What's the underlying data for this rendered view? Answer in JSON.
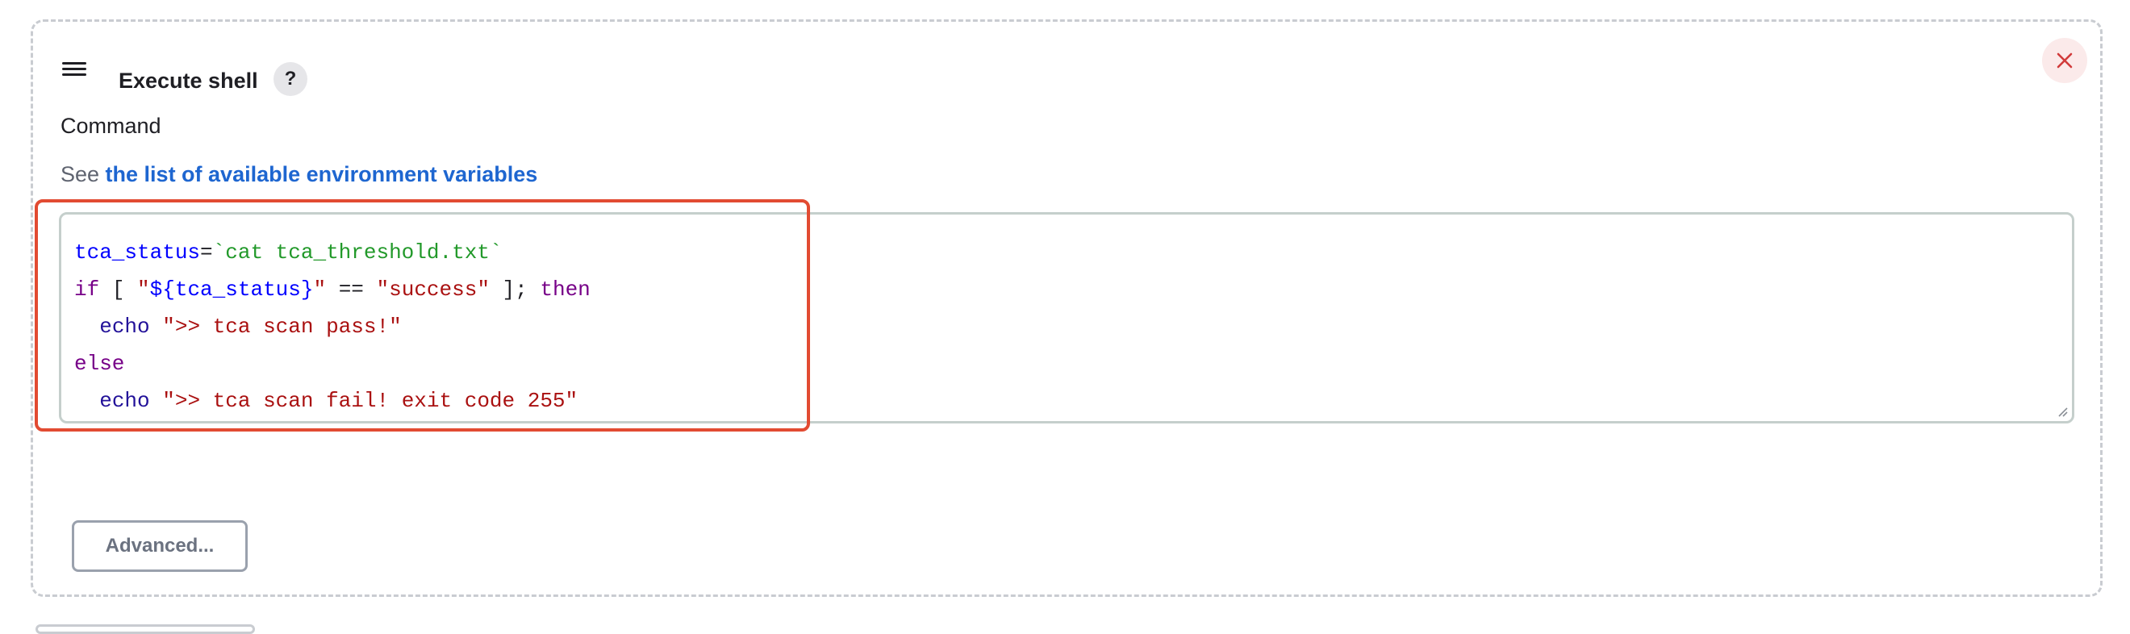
{
  "builder": {
    "title": "Execute shell",
    "help_label": "?",
    "close_icon": "close-icon",
    "handle_icon": "drag-handle-icon"
  },
  "command": {
    "label": "Command",
    "see_prefix": "See ",
    "env_link": "the list of available environment variables",
    "lines": [
      [
        [
          "var",
          "tca_status"
        ],
        [
          "plain",
          "="
        ],
        [
          "cmd",
          "`cat tca_threshold.txt`"
        ]
      ],
      [
        [
          "kw",
          "if"
        ],
        [
          "plain",
          " [ "
        ],
        [
          "str",
          "\""
        ],
        [
          "var",
          "${tca_status}"
        ],
        [
          "str",
          "\""
        ],
        [
          "plain",
          " == "
        ],
        [
          "str",
          "\"success\""
        ],
        [
          "plain",
          " ]; "
        ],
        [
          "kw",
          "then"
        ]
      ],
      [
        [
          "plain",
          "  "
        ],
        [
          "bi",
          "echo"
        ],
        [
          "plain",
          " "
        ],
        [
          "str",
          "\">> tca scan pass!\""
        ]
      ],
      [
        [
          "kw",
          "else"
        ]
      ],
      [
        [
          "plain",
          "  "
        ],
        [
          "bi",
          "echo"
        ],
        [
          "plain",
          " "
        ],
        [
          "str",
          "\">> tca scan fail! exit code 255\""
        ]
      ]
    ]
  },
  "advanced": {
    "label": "Advanced..."
  },
  "colors": {
    "highlight": "#e24b32",
    "link": "#1e66d0",
    "keyword": "#770088",
    "variable": "#0000ff",
    "string": "#aa1111",
    "command": "#22992a"
  }
}
